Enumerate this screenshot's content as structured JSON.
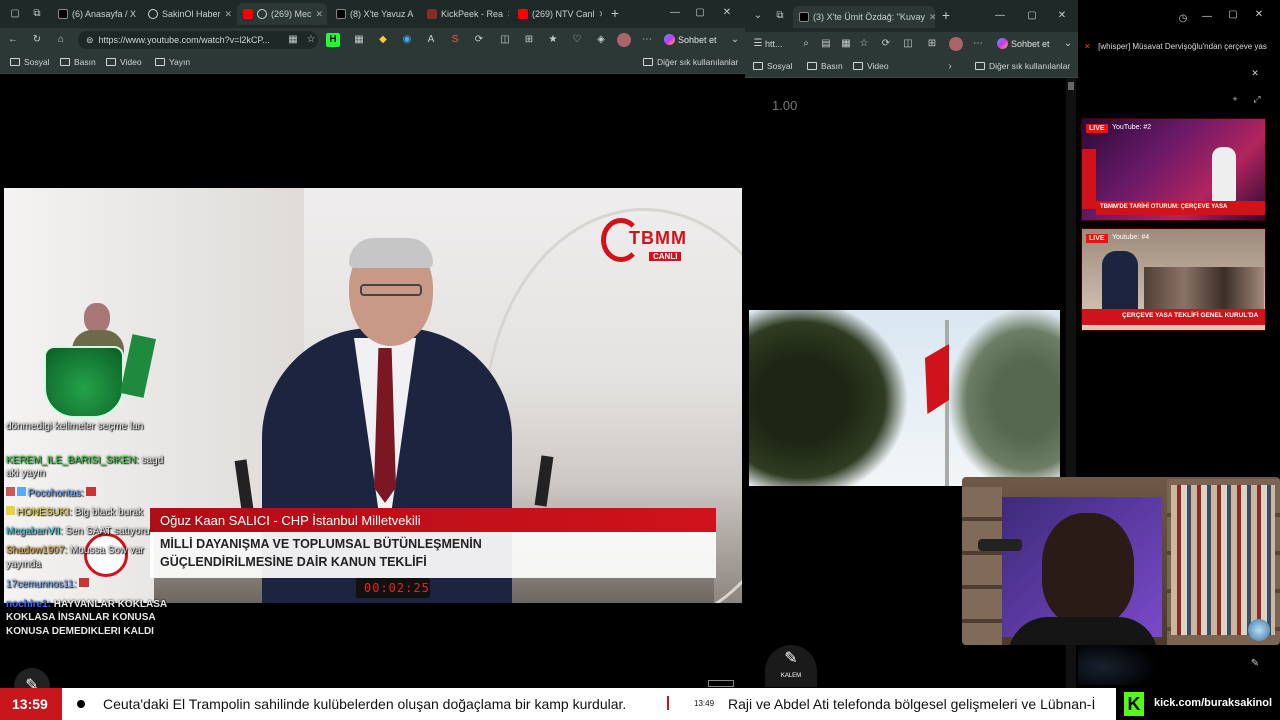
{
  "left_window": {
    "tabs": [
      {
        "label": "(6) Anasayfa / X"
      },
      {
        "label": "SakinOl Haber"
      },
      {
        "label": "(269) Mec"
      },
      {
        "label": "(8) X'te Yavuz A"
      },
      {
        "label": "KickPeek - Rea"
      },
      {
        "label": "(269) NTV Canl"
      }
    ],
    "url": "https://www.youtube.com/watch?v=l2kCP...",
    "sohbet": "Sohbet et",
    "bookmarks": [
      "Sosyal",
      "Basın",
      "Video",
      "Yayın"
    ],
    "other_bookmarks": "Diğer sık kullanılanlar"
  },
  "right_window": {
    "tab_label": "(3) X'te Ümit Özdağ: \"Kuvay",
    "url": "htt...",
    "sohbet": "Sohbet et",
    "bookmarks": [
      "Sosyal",
      "Basın",
      "Video"
    ],
    "other_bookmarks": "Diğer sık kullanılanlar",
    "speed": "1.00"
  },
  "overlay": {
    "broadcast_text": "[whisper] Müsavat Dervişoğlu'ndan çerçeve yas",
    "thumb1_badge": "LIVE",
    "thumb1_title": "YouTube: #2",
    "thumb1_caption": "TBMM'DE TARİHİ OTURUM: ÇERÇEVE YASA",
    "thumb2_badge": "LIVE",
    "thumb2_title": "Youtube: #4",
    "thumb2_caption": "ÇERÇEVE YASA TEKLİFİ GENEL KURUL'DA"
  },
  "tv": {
    "logo_text": "TBMM",
    "logo_sub": "CANLI",
    "lower_third_name": "Oğuz Kaan SALICI - CHP İstanbul Milletvekili",
    "lower_third_line1": "MİLLİ DAYANIŞMA VE TOPLUMSAL BÜTÜNLEŞMENİN",
    "lower_third_line2": "GÜÇLENDİRİLMESİNE DAİR KANUN TEKLİFİ",
    "timer": "00:02:25"
  },
  "chat": [
    {
      "user": "",
      "text": "dönmedigi kelimeler seçme lan"
    },
    {
      "user": "KEREM_ILE_BARISI_SIKEN:",
      "text": " sagd",
      "user_color": "#36c93a"
    },
    {
      "user": "",
      "text": "aki yayın"
    },
    {
      "user": "Pocohontas:",
      "text": "",
      "user_color": "#5aa0ff"
    },
    {
      "user": "HONESUKI:",
      "text": " Big black burak",
      "user_color": "#e6d23a"
    },
    {
      "user": "MegabanVII:",
      "text": " Sen SAAT satıyoru",
      "user_color": "#36d7d7"
    },
    {
      "user": "Shadow1907:",
      "text": " Moussa Sow var",
      "user_color": "#e0a23a"
    },
    {
      "user": "",
      "text": "yayında"
    },
    {
      "user": "17cemunnos11:",
      "text": "",
      "user_color": "#6aa6ff"
    },
    {
      "user": "nochire1:",
      "text": " HAYVANLAR KOKLASA",
      "user_color": "#3a6cff"
    },
    {
      "user": "",
      "text": "KOKLASA İNSANLAR KONUSA"
    },
    {
      "user": "",
      "text": "KONUSA DEMEDIKLERI KALDI"
    }
  ],
  "kalem_label": "KALEM",
  "ticker": {
    "clock": "13:59",
    "headline1": "Ceuta'daki El Trampolin sahilinde kulübelerden oluşan doğaçlama bir kamp kurdular.",
    "small_time": "13:49",
    "headline2": "Raji ve Abdel Ati telefonda bölgesel gelişmeleri ve Lübnan-İ",
    "brand_logo": "K",
    "brand_url": "kick.com/buraksakinol"
  },
  "colors": {
    "accent_red": "#c8161d",
    "kick_green": "#53fc18",
    "chrome_dark": "#1f2a28"
  }
}
